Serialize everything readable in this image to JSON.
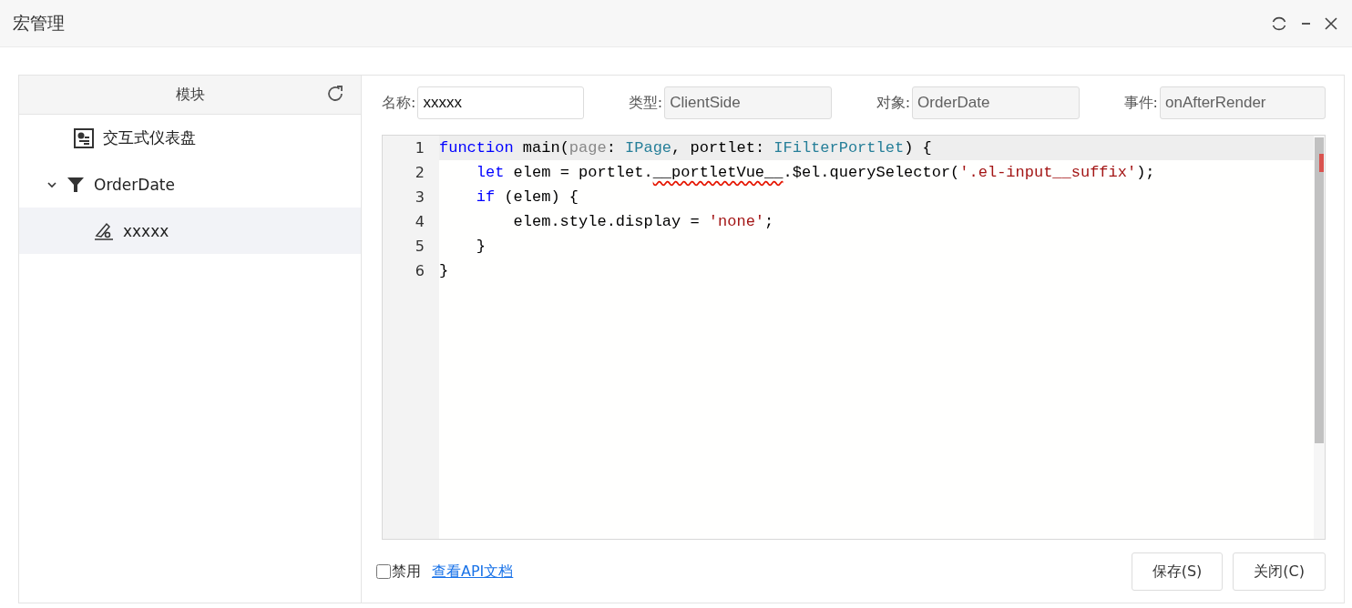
{
  "window": {
    "title": "宏管理"
  },
  "sidebar": {
    "title": "模块",
    "items": [
      {
        "kind": "dashboard",
        "label": "交互式仪表盘",
        "selected": false
      },
      {
        "kind": "filter",
        "label": "OrderDate",
        "selected": false,
        "expanded": true,
        "children": [
          {
            "kind": "macro",
            "label": "xxxxx",
            "selected": true
          }
        ]
      }
    ]
  },
  "fields": [
    {
      "label": "名称:",
      "value": "xxxxx",
      "disabled": false
    },
    {
      "label": "类型:",
      "value": "ClientSide",
      "disabled": true
    },
    {
      "label": "对象:",
      "value": "OrderDate",
      "disabled": true
    },
    {
      "label": "事件:",
      "value": "onAfterRender",
      "disabled": true
    }
  ],
  "editor": {
    "lines": [
      {
        "number": "1",
        "tokens": [
          {
            "kind": "keyword",
            "text": "function"
          },
          {
            "kind": "plain",
            "text": " main("
          },
          {
            "kind": "param",
            "text": "page"
          },
          {
            "kind": "plain",
            "text": ": "
          },
          {
            "kind": "type",
            "text": "IPage"
          },
          {
            "kind": "plain",
            "text": ", portlet: "
          },
          {
            "kind": "type",
            "text": "IFilterPortlet"
          },
          {
            "kind": "plain",
            "text": ") {"
          }
        ]
      },
      {
        "number": "2",
        "tokens": [
          {
            "kind": "keyword",
            "text": "    let"
          },
          {
            "kind": "plain",
            "text": " elem = portlet."
          },
          {
            "kind": "error",
            "text": "__portletVue__"
          },
          {
            "kind": "plain",
            "text": ".$el.querySelector("
          },
          {
            "kind": "string",
            "text": "'.el-input__suffix'"
          },
          {
            "kind": "plain",
            "text": ");"
          }
        ]
      },
      {
        "number": "3",
        "tokens": [
          {
            "kind": "keyword",
            "text": "    if"
          },
          {
            "kind": "plain",
            "text": " (elem) {"
          }
        ]
      },
      {
        "number": "4",
        "tokens": [
          {
            "kind": "plain",
            "text": "        elem.style.display = "
          },
          {
            "kind": "string",
            "text": "'none'"
          },
          {
            "kind": "plain",
            "text": ";"
          }
        ]
      },
      {
        "number": "5",
        "tokens": [
          {
            "kind": "plain",
            "text": "    }"
          }
        ]
      },
      {
        "number": "6",
        "tokens": [
          {
            "kind": "plain",
            "text": "}"
          }
        ]
      }
    ]
  },
  "footer": {
    "disable_checkbox": {
      "label": "禁用",
      "checked": false
    },
    "link": "查看API文档",
    "buttons": [
      "保存(S)",
      "关闭(C)"
    ]
  }
}
